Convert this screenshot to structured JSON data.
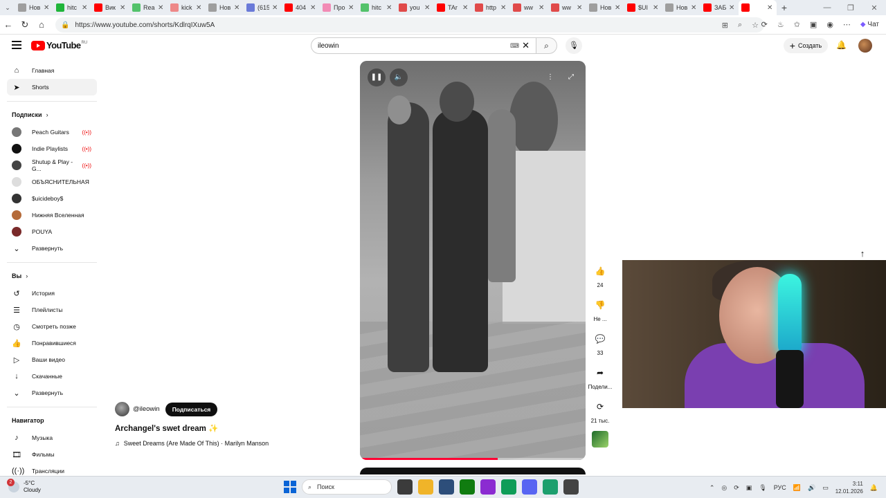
{
  "browser": {
    "tabs": [
      {
        "label": "Нов",
        "color": "#9e9e9e"
      },
      {
        "label": "hitc",
        "color": "#1fb53a"
      },
      {
        "label": "Вик",
        "color": "#ff0000"
      },
      {
        "label": "Rea",
        "color": "#53c26b"
      },
      {
        "label": "kick",
        "color": "#e88"
      },
      {
        "label": "Нов",
        "color": "#9e9e9e"
      },
      {
        "label": "(615",
        "color": "#6a7ad8"
      },
      {
        "label": "404",
        "color": "#ff0000"
      },
      {
        "label": "Про",
        "color": "#f28bb5"
      },
      {
        "label": "hitc",
        "color": "#53c26b"
      },
      {
        "label": "you",
        "color": "#e04a4a"
      },
      {
        "label": "TAr",
        "color": "#ff0000"
      },
      {
        "label": "http",
        "color": "#e04a4a"
      },
      {
        "label": "ww",
        "color": "#e04a4a"
      },
      {
        "label": "ww",
        "color": "#e04a4a"
      },
      {
        "label": "Нов",
        "color": "#9e9e9e"
      },
      {
        "label": "$UI",
        "color": "#ff0000"
      },
      {
        "label": "Нов",
        "color": "#9e9e9e"
      },
      {
        "label": "ЗАБ",
        "color": "#ff0000"
      },
      {
        "label": "",
        "color": "#ff0000"
      }
    ],
    "url": "https://www.youtube.com/shorts/KdlrqIXuw5A",
    "chat_label": "Чат"
  },
  "header": {
    "logo_text": "YouTube",
    "logo_region": "RU",
    "search_value": "ileowin",
    "create_label": "Создать"
  },
  "sidebar": {
    "main": [
      {
        "label": "Главная",
        "icon": "home-icon",
        "glyph": "⌂"
      },
      {
        "label": "Shorts",
        "icon": "shorts-icon",
        "glyph": "➤"
      }
    ],
    "subs_title": "Подписки",
    "subs": [
      {
        "label": "Peach Guitars",
        "live": true,
        "color": "#777"
      },
      {
        "label": "Indie Playlists",
        "live": true,
        "color": "#111"
      },
      {
        "label": "Shutup & Play - G...",
        "live": true,
        "color": "#444"
      },
      {
        "label": "ОБЪЯСНИТЕЛЬНАЯ",
        "live": false,
        "color": "#ddd"
      },
      {
        "label": "$uicideboy$",
        "live": false,
        "color": "#333"
      },
      {
        "label": "Нижняя Вселенная",
        "live": false,
        "color": "#b56b3a"
      },
      {
        "label": "POUYA",
        "live": false,
        "color": "#7a2a2a"
      }
    ],
    "expand_label": "Развернуть",
    "you_title": "Вы",
    "you": [
      {
        "label": "История",
        "icon": "history-icon",
        "glyph": "↺"
      },
      {
        "label": "Плейлисты",
        "icon": "playlists-icon",
        "glyph": "☰"
      },
      {
        "label": "Смотреть позже",
        "icon": "watch-later-icon",
        "glyph": "◷"
      },
      {
        "label": "Понравившиеся",
        "icon": "like-icon",
        "glyph": "👍"
      },
      {
        "label": "Ваши видео",
        "icon": "your-videos-icon",
        "glyph": "▷"
      },
      {
        "label": "Скачанные",
        "icon": "download-icon",
        "glyph": "↓"
      }
    ],
    "expand2_label": "Развернуть",
    "nav_title": "Навигатор",
    "nav": [
      {
        "label": "Музыка",
        "icon": "music-icon",
        "glyph": "♪"
      },
      {
        "label": "Фильмы",
        "icon": "movies-icon",
        "glyph": "🎞"
      },
      {
        "label": "Трансляции",
        "icon": "live-icon",
        "glyph": "((·))"
      }
    ]
  },
  "video": {
    "progress": 0.61,
    "channel": "@ileowin",
    "subscribe_label": "Подписаться",
    "title": "Archangel's swet dream",
    "title_emoji": "✨",
    "music": "Sweet Dreams (Are Made Of This) · Marilyn Manson"
  },
  "actions": {
    "likes": "24",
    "dislike": "Не ...",
    "comments": "33",
    "share": "Подели...",
    "remix": "21 тыс."
  },
  "taskbar": {
    "weather_temp": "-5°C",
    "weather_desc": "Cloudy",
    "weather_badge": "2",
    "search_label": "Поиск",
    "lang": "РУС",
    "time": "3:11",
    "date": "12.01.2026"
  }
}
